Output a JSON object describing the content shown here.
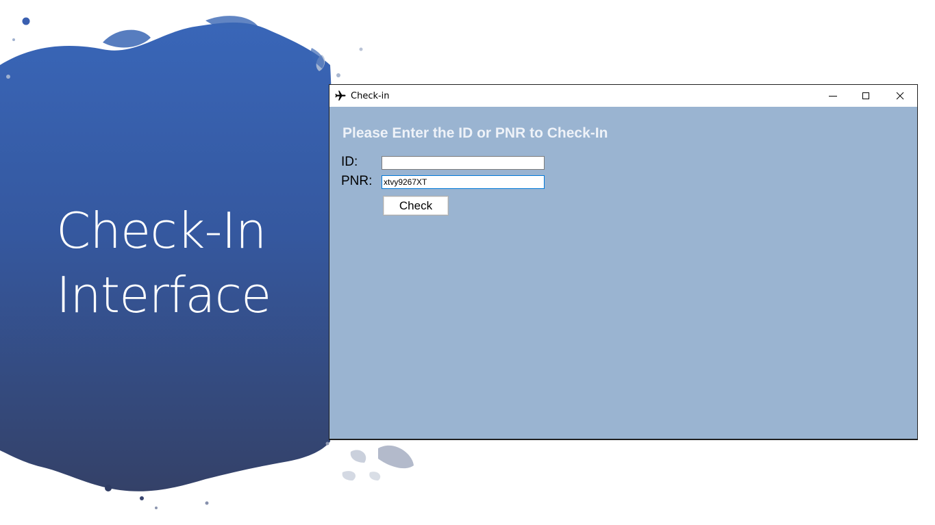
{
  "slide": {
    "title_lines": [
      "Check-In",
      "Interface"
    ],
    "splash_color": "#3a64b2"
  },
  "window": {
    "title": "Check-in",
    "icon": "airplane-icon",
    "controls": [
      "minimize-icon",
      "maximize-icon",
      "close-icon"
    ],
    "heading": "Please Enter the ID or PNR to Check-In",
    "background_color": "#9ab4d1",
    "form": {
      "id_label": "ID:",
      "id_value": "",
      "pnr_label": "PNR:",
      "pnr_value": "xtvy9267XT",
      "check_label": "Check"
    }
  }
}
